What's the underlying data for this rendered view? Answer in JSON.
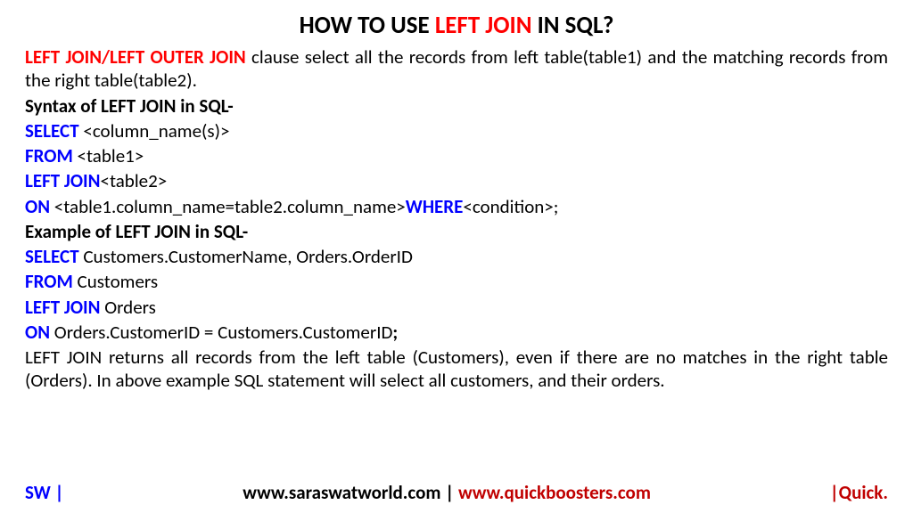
{
  "title": {
    "part1": "HOW TO USE ",
    "highlight": "LEFT JOIN",
    "part2": " IN SQL?"
  },
  "intro": {
    "highlight": "LEFT JOIN/LEFT OUTER JOIN",
    "text": " clause select all the records from left table(table1) and the matching records from the right table(table2)."
  },
  "syntax_header": "Syntax of LEFT JOIN in SQL-",
  "syntax": {
    "line1_kw": "SELECT",
    "line1_rest": " <column_name(s)>",
    "line2_kw": "FROM",
    "line2_rest": " <table1>",
    "line3_kw": "LEFT JOIN",
    "line3_rest": "<table2>",
    "line4_kw1": "ON",
    "line4_mid": " <table1.column_name=table2.column_name>",
    "line4_kw2": "WHERE",
    "line4_end": "<condition>;"
  },
  "example_header": "Example of LEFT JOIN in SQL-",
  "example": {
    "line1_kw": "SELECT",
    "line1_rest": " Customers.CustomerName, Orders.OrderID",
    "line2_kw": "FROM",
    "line2_rest": " Customers",
    "line3_kw": "LEFT JOIN",
    "line3_rest": " Orders",
    "line4_kw": "ON",
    "line4_rest": " Orders.CustomerID = Customers.CustomerID",
    "line4_semi": ";"
  },
  "explanation": "LEFT JOIN returns all records from the left table (Customers), even if there are no matches in the right table (Orders). In above example SQL statement will select all customers, and their orders.",
  "footer": {
    "left": "SW |",
    "center_part1": "www.saraswatworld.com | ",
    "center_red": "www.quickboosters.com",
    "right": "|Quick."
  }
}
